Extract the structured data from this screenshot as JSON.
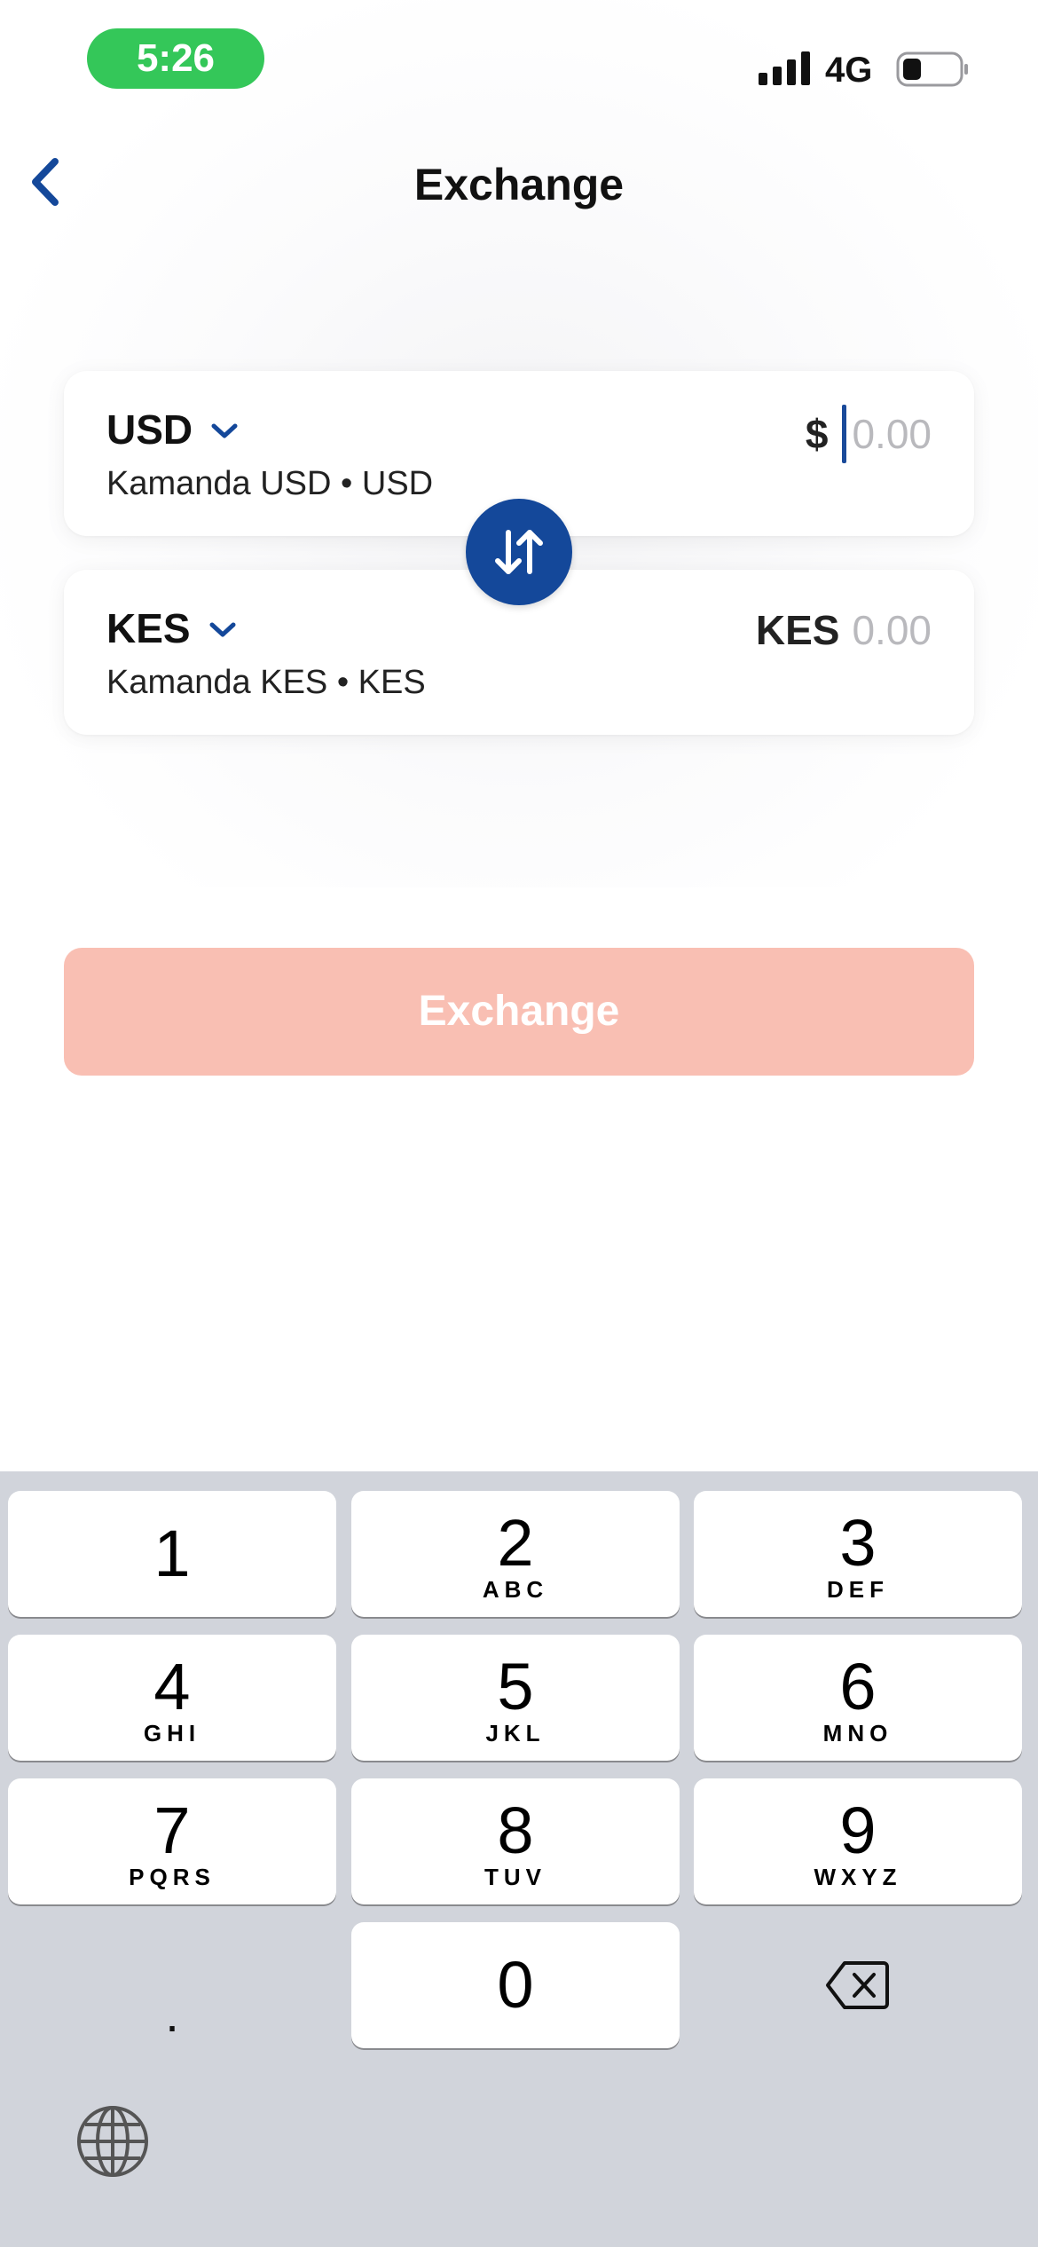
{
  "status_bar": {
    "time": "5:26",
    "network": "4G",
    "time_pill_color": "#34c759"
  },
  "header": {
    "title": "Exchange",
    "back_icon": "chevron-left-icon"
  },
  "from_card": {
    "currency_code": "USD",
    "account_label": "Kamanda USD • USD",
    "amount_prefix": "$",
    "amount_placeholder": "0.00"
  },
  "to_card": {
    "currency_code": "KES",
    "account_label": "Kamanda KES • KES",
    "amount_prefix": "KES",
    "amount_placeholder": "0.00"
  },
  "swap_button": {
    "icon": "swap-arrows-icon",
    "color": "#14489a"
  },
  "exchange_button": {
    "label": "Exchange",
    "state": "disabled",
    "color": "#f9bfb3"
  },
  "keyboard": {
    "keys": [
      {
        "digit": "1",
        "letters": ""
      },
      {
        "digit": "2",
        "letters": "ABC"
      },
      {
        "digit": "3",
        "letters": "DEF"
      },
      {
        "digit": "4",
        "letters": "GHI"
      },
      {
        "digit": "5",
        "letters": "JKL"
      },
      {
        "digit": "6",
        "letters": "MNO"
      },
      {
        "digit": "7",
        "letters": "PQRS"
      },
      {
        "digit": "8",
        "letters": "TUV"
      },
      {
        "digit": "9",
        "letters": "WXYZ"
      },
      {
        "digit": "0",
        "letters": ""
      }
    ],
    "decimal_key": ".",
    "delete_icon": "backspace-icon",
    "globe_icon": "globe-icon"
  },
  "accent_color": "#14489a"
}
